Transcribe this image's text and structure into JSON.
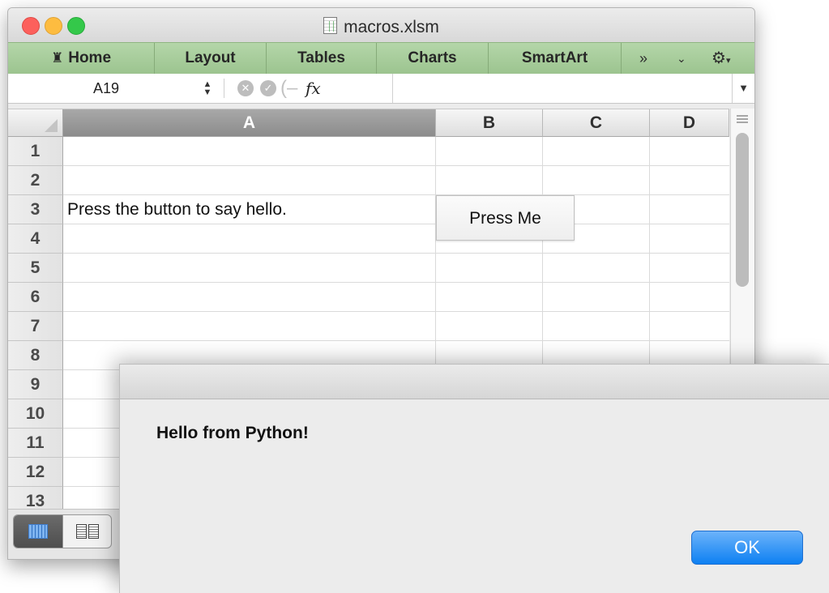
{
  "window": {
    "title": "macros.xlsm"
  },
  "ribbon": {
    "tabs": [
      "Home",
      "Layout",
      "Tables",
      "Charts",
      "SmartArt"
    ],
    "overflow_icon": "chevron-double-right-icon",
    "collapse_icon": "chevron-down-icon",
    "settings_icon": "gear-icon"
  },
  "formula_bar": {
    "name_box": "A19",
    "fx_label": "fx",
    "formula_value": ""
  },
  "sheet": {
    "columns": [
      "A",
      "B",
      "C",
      "D"
    ],
    "selected_column": "A",
    "rows": [
      "1",
      "2",
      "3",
      "4",
      "5",
      "6",
      "7",
      "8",
      "9",
      "10",
      "11",
      "12",
      "13"
    ],
    "cells": {
      "A3": "Press the button to say hello."
    },
    "button_label": "Press Me"
  },
  "view_buttons": {
    "normal": "normal-view-icon",
    "page_layout": "page-layout-view-icon"
  },
  "dialog": {
    "message": "Hello from Python!",
    "ok_label": "OK"
  }
}
